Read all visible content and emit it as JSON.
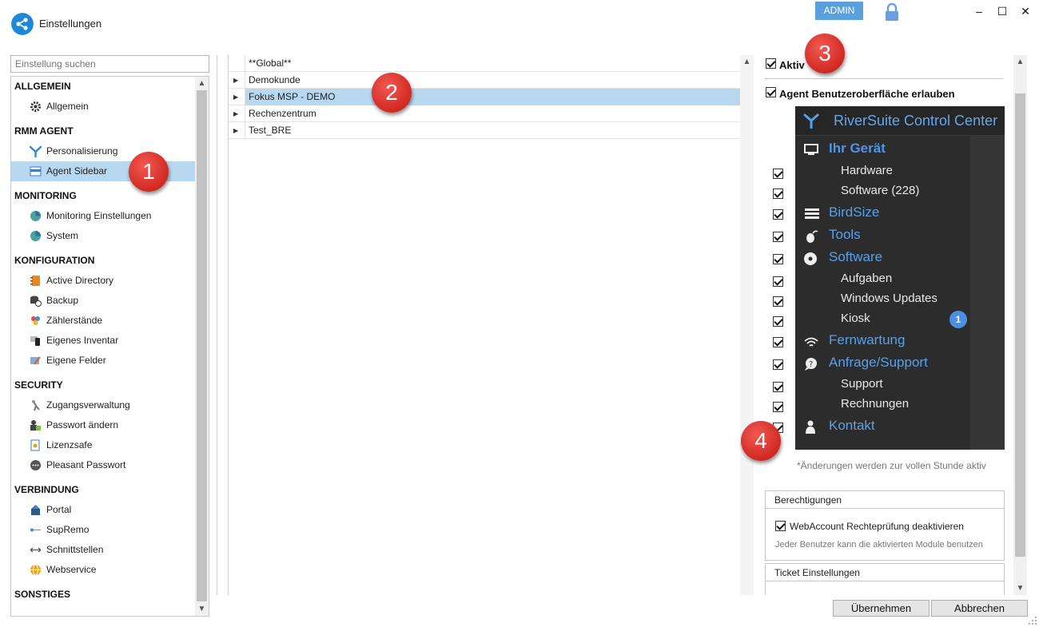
{
  "window": {
    "title": "Einstellungen",
    "admin_badge": "ADMIN",
    "minimize": "–",
    "maximize": "☐",
    "close": "✕"
  },
  "search": {
    "placeholder": "Einstellung suchen"
  },
  "nav": {
    "sections": [
      {
        "title": "ALLGEMEIN",
        "items": [
          {
            "label": "Allgemein",
            "icon": "gear-icon"
          }
        ]
      },
      {
        "title": "RMM AGENT",
        "items": [
          {
            "label": "Personalisierung",
            "icon": "riversuite-logo-icon"
          },
          {
            "label": "Agent Sidebar",
            "icon": "sidebar-icon",
            "selected": true
          }
        ]
      },
      {
        "title": "MONITORING",
        "items": [
          {
            "label": "Monitoring Einstellungen",
            "icon": "monitoring-icon"
          },
          {
            "label": "System",
            "icon": "system-icon"
          }
        ]
      },
      {
        "title": "KONFIGURATION",
        "items": [
          {
            "label": "Active Directory",
            "icon": "directory-icon"
          },
          {
            "label": "Backup",
            "icon": "backup-icon"
          },
          {
            "label": "Zählerstände",
            "icon": "counter-icon"
          },
          {
            "label": "Eigenes Inventar",
            "icon": "inventory-icon"
          },
          {
            "label": "Eigene Felder",
            "icon": "fields-icon"
          }
        ]
      },
      {
        "title": "SECURITY",
        "items": [
          {
            "label": "Zugangsverwaltung",
            "icon": "access-icon"
          },
          {
            "label": "Passwort ändern",
            "icon": "password-icon"
          },
          {
            "label": "Lizenzsafe",
            "icon": "license-icon"
          },
          {
            "label": "Pleasant Passwort",
            "icon": "pleasant-icon"
          }
        ]
      },
      {
        "title": "VERBINDUNG",
        "items": [
          {
            "label": "Portal",
            "icon": "portal-icon"
          },
          {
            "label": "SupRemo",
            "icon": "supremo-icon"
          },
          {
            "label": "Schnittstellen",
            "icon": "interface-icon"
          },
          {
            "label": "Webservice",
            "icon": "globe-icon"
          }
        ]
      },
      {
        "title": "SONSTIGES",
        "items": []
      }
    ]
  },
  "tree": {
    "rows": [
      {
        "label": "**Global**",
        "expandable": false
      },
      {
        "label": "Demokunde",
        "expandable": true
      },
      {
        "label": "Fokus MSP - DEMO",
        "expandable": true,
        "selected": true
      },
      {
        "label": "Rechenzentrum",
        "expandable": true
      },
      {
        "label": "Test_BRE",
        "expandable": true
      }
    ]
  },
  "right": {
    "aktiv_label": "Aktiv",
    "agent_ui_label": "Agent Benutzeroberfläche erlauben",
    "preview": {
      "title": "RiverSuite Control Center",
      "items": [
        {
          "label": "Ihr Gerät",
          "type": "main",
          "icon": "monitor-icon",
          "active": true
        },
        {
          "label": "Hardware",
          "type": "sub"
        },
        {
          "label": "Software (228)",
          "type": "sub"
        },
        {
          "label": "BirdSize",
          "type": "main",
          "icon": "list-icon"
        },
        {
          "label": "Tools",
          "type": "main",
          "icon": "mouse-icon"
        },
        {
          "label": "Software",
          "type": "main",
          "icon": "disc-icon"
        },
        {
          "label": "Aufgaben",
          "type": "sub"
        },
        {
          "label": "Windows Updates",
          "type": "sub"
        },
        {
          "label": "Kiosk",
          "type": "sub"
        },
        {
          "label": "Fernwartung",
          "type": "main",
          "icon": "wifi-icon"
        },
        {
          "label": "Anfrage/Support",
          "type": "main",
          "icon": "chat-icon"
        },
        {
          "label": "Support",
          "type": "sub"
        },
        {
          "label": "Rechnungen",
          "type": "sub"
        },
        {
          "label": "Kontakt",
          "type": "main",
          "icon": "person-icon"
        }
      ],
      "kiosk_badge": "1"
    },
    "note": "*Änderungen werden zur vollen Stunde aktiv",
    "permissions": {
      "title": "Berechtigungen",
      "check_label": "WebAccount Rechteprüfung deaktivieren",
      "description": "Jeder Benutzer kann die aktivierten Module benutzen"
    },
    "ticket": {
      "title": "Ticket Einstellungen"
    }
  },
  "buttons": {
    "apply": "Übernehmen",
    "cancel": "Abbrechen"
  },
  "callouts": [
    "1",
    "2",
    "3",
    "4"
  ],
  "colors": {
    "accent": "#1e88d6",
    "selection": "#b8d8f0",
    "preview_bg": "#2c2c2c",
    "preview_link": "#5aa0e6",
    "callout": "#d32c25"
  }
}
